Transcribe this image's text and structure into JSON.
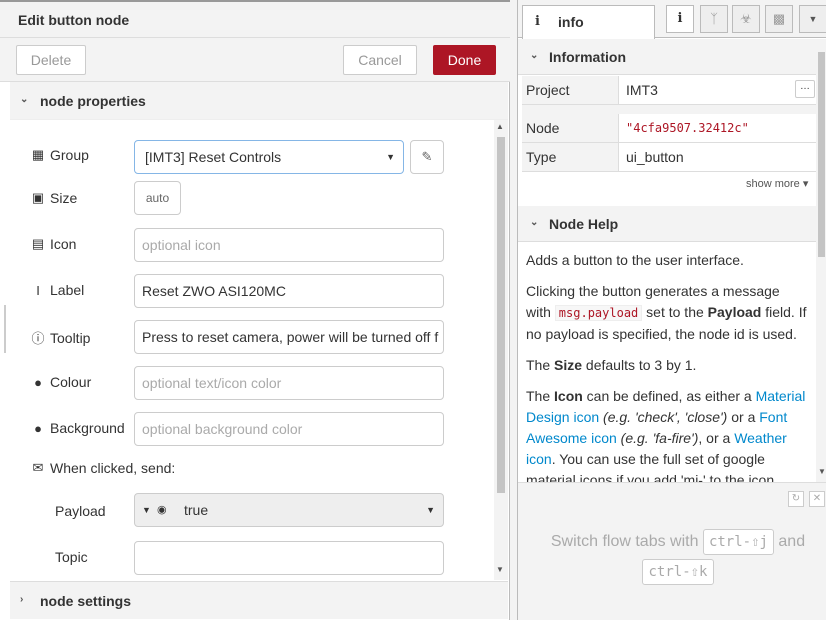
{
  "tray": {
    "title": "Edit button node",
    "delete_label": "Delete",
    "cancel_label": "Cancel",
    "done_label": "Done",
    "section_properties": "node properties",
    "section_settings": "node settings"
  },
  "form": {
    "group": {
      "label": "Group",
      "value": "[IMT3] Reset Controls",
      "icon": "table-icon"
    },
    "size": {
      "label": "Size",
      "value": "auto",
      "icon": "resize-icon"
    },
    "icon_field": {
      "label": "Icon",
      "placeholder": "optional icon",
      "icon": "image-icon"
    },
    "label_field": {
      "label": "Label",
      "value": "Reset ZWO ASI120MC",
      "icon": "text-cursor-icon"
    },
    "tooltip": {
      "label": "Tooltip",
      "value": "Press to reset camera, power will be turned off f",
      "icon": "info-circle-icon"
    },
    "colour": {
      "label": "Colour",
      "placeholder": "optional text/icon color",
      "icon": "tint-icon"
    },
    "background": {
      "label": "Background",
      "placeholder": "optional background color",
      "icon": "tint-icon"
    },
    "when_clicked": {
      "label": "When clicked, send:",
      "icon": "envelope-icon"
    },
    "payload": {
      "label": "Payload",
      "value": "true"
    },
    "topic": {
      "label": "Topic",
      "value": ""
    }
  },
  "sidebar": {
    "tab_label": "info",
    "information_title": "Information",
    "table": [
      {
        "key": "Project",
        "value": "IMT3"
      },
      {
        "key": "Node",
        "value": "\"4cfa9507.32412c\""
      },
      {
        "key": "Type",
        "value": "ui_button"
      }
    ],
    "show_more": "show more ▾",
    "help_title": "Node Help",
    "help": {
      "p1": "Adds a button to the user interface.",
      "p2_a": "Clicking the button generates a message with ",
      "p2_code": "msg.payload",
      "p2_b": " set to the ",
      "p2_bold": "Payload",
      "p2_c": " field. If no payload is specified, the node id is used.",
      "p3_a": "The ",
      "p3_bold": "Size",
      "p3_b": " defaults to 3 by 1.",
      "p4_a": "The ",
      "p4_bold": "Icon",
      "p4_b": " can be defined, as either a ",
      "p4_link1": "Material Design icon",
      "p4_c": " (e.g. 'check', 'close')",
      "p4_d": " or a ",
      "p4_link2": "Font Awesome icon",
      "p4_e": " (e.g. 'fa-fire')",
      "p4_f": ", or a ",
      "p4_link3": "Weather icon",
      "p4_g": ". You can use the full set of google material icons if you add 'mi-' to the icon"
    },
    "bottom": {
      "tip_a": "Switch flow tabs with",
      "key1": "ctrl-⇧j",
      "tip_b": "and",
      "key2": "ctrl-⇧k"
    }
  },
  "colors": {
    "accent": "#ad1625",
    "link": "#0088cc",
    "focus_border": "#85b6e6"
  }
}
